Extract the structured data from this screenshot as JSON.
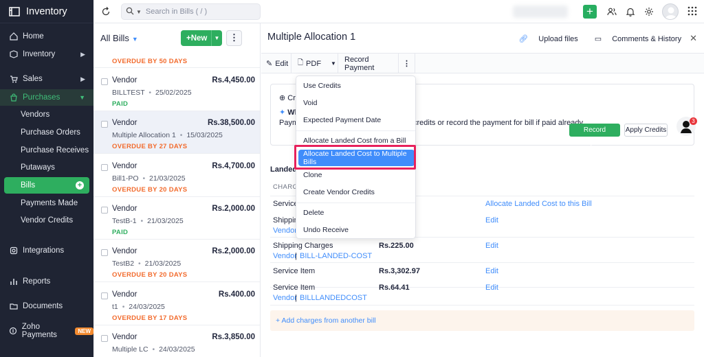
{
  "app": {
    "name": "Inventory"
  },
  "sidebar": {
    "items": [
      {
        "label": "Home"
      },
      {
        "label": "Inventory"
      },
      {
        "label": "Sales"
      },
      {
        "label": "Purchases"
      },
      {
        "label": "Vendors"
      },
      {
        "label": "Purchase Orders"
      },
      {
        "label": "Purchase Receives"
      },
      {
        "label": "Putaways"
      },
      {
        "label": "Bills"
      },
      {
        "label": "Payments Made"
      },
      {
        "label": "Vendor Credits"
      },
      {
        "label": "Integrations"
      },
      {
        "label": "Reports"
      },
      {
        "label": "Documents"
      },
      {
        "label": "Zoho Payments"
      }
    ],
    "new_badge": "NEW"
  },
  "topbar": {
    "search_placeholder": "Search in Bills ( / )",
    "add_symbol": "+"
  },
  "list": {
    "title": "All Bills",
    "new_label": "+New",
    "more_symbol": "⋮",
    "top_status": "OVERDUE BY 50 DAYS",
    "rows": [
      {
        "vendor": "Vendor",
        "amount": "Rs.4,450.00",
        "ref": "BILLTEST",
        "date": "25/02/2025",
        "status": "PAID"
      },
      {
        "vendor": "Vendor",
        "amount": "Rs.38,500.00",
        "ref": "Multiple Allocation 1",
        "date": "15/03/2025",
        "status": "OVERDUE BY 27 DAYS"
      },
      {
        "vendor": "Vendor",
        "amount": "Rs.4,700.00",
        "ref": "Bill1-PO",
        "date": "21/03/2025",
        "status": "OVERDUE BY 20 DAYS"
      },
      {
        "vendor": "Vendor",
        "amount": "Rs.2,000.00",
        "ref": "TestB-1",
        "date": "21/03/2025",
        "status": "PAID"
      },
      {
        "vendor": "Vendor",
        "amount": "Rs.2,000.00",
        "ref": "TestB2",
        "date": "21/03/2025",
        "status": "OVERDUE BY 20 DAYS"
      },
      {
        "vendor": "Vendor",
        "amount": "Rs.400.00",
        "ref": "t1",
        "date": "24/03/2025",
        "status": "OVERDUE BY 17 DAYS"
      },
      {
        "vendor": "Vendor",
        "amount": "Rs.3,850.00",
        "ref": "Multiple LC",
        "date": "24/03/2025",
        "status": ""
      }
    ],
    "separator": "•"
  },
  "detail": {
    "title": "Multiple Allocation 1",
    "upload": "Upload files",
    "comments": "Comments & History",
    "close_symbol": "✕",
    "toolbar": {
      "edit": "Edit",
      "pdf": "PDF",
      "record_payment": "Record Payment"
    },
    "card": {
      "top_text": "Cre",
      "what_text": "Wh",
      "pay_prefix": "Paym",
      "pay_suffix": "credits or record the payment for bill if paid already.",
      "record_payment": "Record Payment",
      "apply_credits": "Apply Credits",
      "badge_count": "3"
    },
    "landed": {
      "title": "Landed",
      "charges_header": "CHARG",
      "rows": [
        {
          "name": "Service",
          "amount": "",
          "action": "Allocate Landed Cost to this Bill",
          "vendor": "",
          "ref": ""
        },
        {
          "name": "Shipping",
          "amount": "",
          "action": "Edit",
          "vendor": "Vendor",
          "ref": ""
        },
        {
          "name": "Shipping Charges",
          "amount": "Rs.225.00",
          "action": "Edit",
          "vendor": "Vendor",
          "ref": "BILL-LANDED-COST"
        },
        {
          "name": "Service Item",
          "amount": "Rs.3,302.97",
          "action": "Edit",
          "vendor": "",
          "ref": ""
        },
        {
          "name": "Service Item",
          "amount": "Rs.64.41",
          "action": "Edit",
          "vendor": "Vendor",
          "ref": "BILLLANDEDCOST"
        }
      ],
      "pipe": "|",
      "add_charges": "+ Add charges from another bill"
    }
  },
  "menu": {
    "items": [
      {
        "label": "Use Credits"
      },
      {
        "label": "Void"
      },
      {
        "label": "Expected Payment Date"
      },
      {
        "label": "Allocate Landed Cost from a Bill"
      },
      {
        "label": "Allocate Landed Cost to Multiple Bills"
      },
      {
        "label": "Clone"
      },
      {
        "label": "Create Vendor Credits"
      },
      {
        "label": "Delete"
      },
      {
        "label": "Undo Receive"
      }
    ]
  },
  "colors": {
    "accent": "#408dfb",
    "primary_green": "#2eae5f",
    "overdue": "#f26b2d",
    "highlight_box": "#e7215c",
    "sidebar_bg": "#1f2433"
  }
}
